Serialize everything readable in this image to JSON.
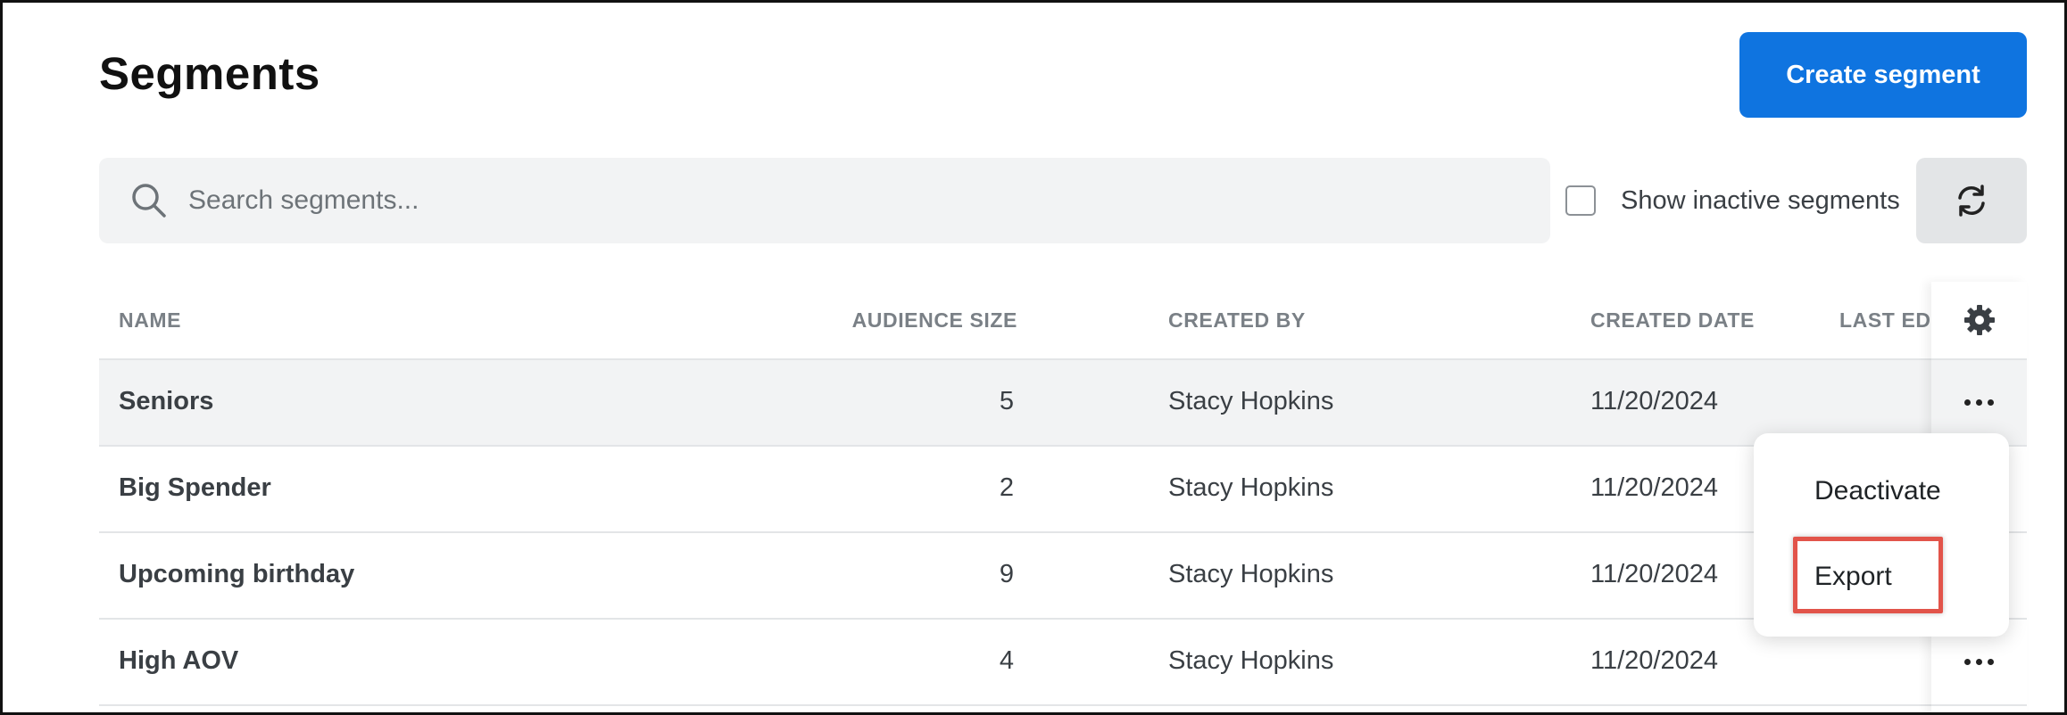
{
  "header": {
    "title": "Segments",
    "create_button": "Create segment"
  },
  "search": {
    "placeholder": "Search segments...",
    "value": ""
  },
  "filters": {
    "show_inactive_label": "Show inactive segments",
    "show_inactive_checked": false
  },
  "icons": {
    "search": "search-icon",
    "refresh": "refresh-icon",
    "settings": "gear-icon",
    "more": "more-horizontal-icon"
  },
  "table": {
    "columns": {
      "name": "NAME",
      "audience_size": "AUDIENCE SIZE",
      "created_by": "CREATED BY",
      "created_date": "CREATED DATE",
      "last_edited": "LAST EDI"
    },
    "rows": [
      {
        "name": "Seniors",
        "audience_size": "5",
        "created_by": "Stacy Hopkins",
        "created_date": "11/20/2024"
      },
      {
        "name": "Big Spender",
        "audience_size": "2",
        "created_by": "Stacy Hopkins",
        "created_date": "11/20/2024"
      },
      {
        "name": "Upcoming birthday",
        "audience_size": "9",
        "created_by": "Stacy Hopkins",
        "created_date": "11/20/2024"
      },
      {
        "name": "High AOV",
        "audience_size": "4",
        "created_by": "Stacy Hopkins",
        "created_date": "11/20/2024"
      }
    ]
  },
  "context_menu": {
    "items": [
      "Deactivate",
      "Export"
    ],
    "highlighted": "Export"
  },
  "colors": {
    "primary": "#0f74e0",
    "annotation_highlight": "#e2544a",
    "row_highlight": "#f2f3f4"
  }
}
